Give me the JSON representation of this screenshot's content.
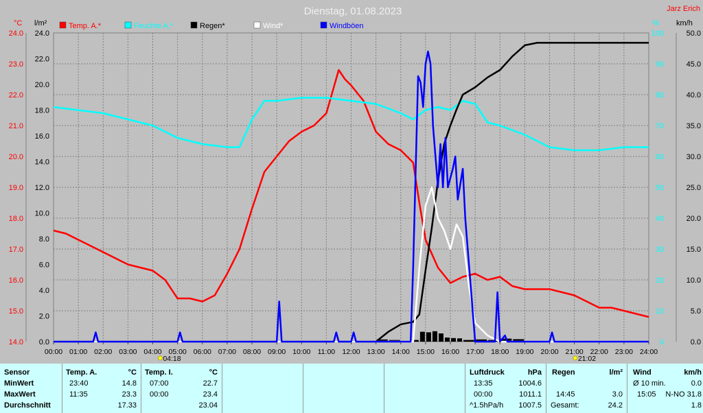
{
  "title": "Dienstag, 01.08.2023",
  "station": "Jarz Erich",
  "units": {
    "temp": "°C",
    "rain": "l/m²",
    "humidity": "%",
    "wind": "km/h"
  },
  "legend": [
    {
      "label": "Temp. A.*",
      "color": "#ff0000"
    },
    {
      "label": "Feuchte A.*",
      "color": "#00ffff"
    },
    {
      "label": "Regen*",
      "color": "#000000"
    },
    {
      "label": "Wind*",
      "color": "#ffffff"
    },
    {
      "label": "Windböen",
      "color": "#0000ff"
    }
  ],
  "sun": {
    "sunrise": "04:18",
    "sunset": "21:02"
  },
  "chart_data": {
    "type": "line",
    "x_unit": "hour",
    "xlim": [
      0,
      24
    ],
    "x_ticks": [
      "00:00",
      "01:00",
      "02:00",
      "03:00",
      "04:00",
      "05:00",
      "06:00",
      "07:00",
      "08:00",
      "09:00",
      "10:00",
      "11:00",
      "12:00",
      "13:00",
      "14:00",
      "15:00",
      "16:00",
      "17:00",
      "18:00",
      "19:00",
      "20:00",
      "21:00",
      "22:00",
      "23:00",
      "24:00"
    ],
    "axes": {
      "temp": {
        "lim": [
          14,
          24
        ],
        "ticks": [
          "14.0",
          "15.0",
          "16.0",
          "17.0",
          "18.0",
          "19.0",
          "20.0",
          "21.0",
          "22.0",
          "23.0",
          "24.0"
        ],
        "color": "#ff0000"
      },
      "rain": {
        "lim": [
          0,
          25
        ],
        "ticks": [
          "0.0",
          "2.0",
          "4.0",
          "6.0",
          "8.0",
          "10.0",
          "12.0",
          "14.0",
          "16.0",
          "18.0",
          "20.0",
          "22.0",
          "24.0"
        ],
        "color": "#000000"
      },
      "humidity": {
        "lim": [
          0,
          100
        ],
        "ticks": [
          "0",
          "10",
          "20",
          "30",
          "40",
          "50",
          "60",
          "70",
          "80",
          "90",
          "100"
        ],
        "color": "#00ffff"
      },
      "wind": {
        "lim": [
          0,
          50
        ],
        "ticks": [
          "0.0",
          "5.0",
          "10.0",
          "15.0",
          "20.0",
          "25.0",
          "30.0",
          "35.0",
          "40.0",
          "45.0",
          "50.0"
        ],
        "color": "#000000"
      }
    },
    "grid": true,
    "series": [
      {
        "name": "Temp. A.*",
        "axis": "temp",
        "color": "#ff0000",
        "x": [
          0,
          0.5,
          1,
          1.5,
          2,
          2.5,
          3,
          3.5,
          4,
          4.5,
          5,
          5.5,
          6,
          6.5,
          7,
          7.5,
          8,
          8.5,
          9,
          9.5,
          10,
          10.5,
          11,
          11.25,
          11.5,
          11.75,
          12,
          12.5,
          13,
          13.5,
          14,
          14.5,
          14.75,
          15,
          15.5,
          16,
          16.5,
          17,
          17.5,
          18,
          18.5,
          19,
          19.5,
          20,
          20.5,
          21,
          21.5,
          22,
          22.5,
          23,
          23.5,
          24
        ],
        "y": [
          17.6,
          17.5,
          17.3,
          17.1,
          16.9,
          16.7,
          16.5,
          16.4,
          16.3,
          16.0,
          15.4,
          15.4,
          15.3,
          15.5,
          16.2,
          17.0,
          18.3,
          19.5,
          20.0,
          20.5,
          20.8,
          21.0,
          21.4,
          22.1,
          22.8,
          22.5,
          22.3,
          21.8,
          20.8,
          20.4,
          20.2,
          19.8,
          18.5,
          17.3,
          16.4,
          15.9,
          16.1,
          16.2,
          16.0,
          16.1,
          15.8,
          15.7,
          15.7,
          15.7,
          15.6,
          15.5,
          15.3,
          15.1,
          15.1,
          15.0,
          14.9,
          14.8
        ]
      },
      {
        "name": "Feuchte A.*",
        "axis": "humidity",
        "color": "#00ffff",
        "x": [
          0,
          1,
          2,
          3,
          4,
          5,
          6,
          7,
          7.5,
          8,
          8.5,
          9,
          10,
          11,
          12,
          13,
          14,
          14.5,
          15,
          15.5,
          16,
          16.5,
          17,
          17.5,
          18,
          19,
          20,
          21,
          22,
          23,
          24
        ],
        "y": [
          76,
          75,
          74,
          72,
          70,
          66,
          64,
          63,
          63,
          72,
          78,
          78,
          79,
          79,
          78,
          77,
          74,
          72,
          75,
          76,
          75,
          78,
          77,
          71,
          70,
          67,
          63,
          62,
          62,
          63,
          63
        ]
      },
      {
        "name": "Regen*",
        "axis": "rain",
        "color": "#000000",
        "x": [
          0,
          13,
          13.5,
          14,
          14.5,
          14.75,
          15,
          15.25,
          15.5,
          15.75,
          16,
          16.25,
          16.5,
          17,
          17.5,
          18,
          18.5,
          19,
          19.5,
          20,
          24
        ],
        "y": [
          0,
          0,
          0.8,
          1.4,
          1.6,
          2.2,
          5.8,
          9.2,
          13.0,
          16.0,
          17.5,
          18.8,
          20.0,
          20.6,
          21.4,
          22.0,
          23.1,
          24.0,
          24.2,
          24.2,
          24.2
        ]
      },
      {
        "name": "Wind*",
        "axis": "wind",
        "color": "#ffffff",
        "x": [
          0,
          14.5,
          14.75,
          15,
          15.25,
          15.5,
          15.75,
          16,
          16.25,
          16.5,
          16.75,
          17,
          17.25,
          17.5,
          17.75,
          18,
          24
        ],
        "y": [
          0,
          0,
          12,
          22,
          25,
          20,
          18,
          15,
          19,
          17,
          9,
          3,
          2,
          1,
          0.5,
          0,
          0
        ]
      },
      {
        "name": "Windböen",
        "axis": "wind",
        "color": "#0000ff",
        "x": [
          0,
          1.6,
          1.7,
          1.8,
          5,
          5.1,
          5.2,
          9,
          9.1,
          9.2,
          11.3,
          11.4,
          11.5,
          12.0,
          12.1,
          12.2,
          12.3,
          14.4,
          14.5,
          14.7,
          14.8,
          14.9,
          15.0,
          15.1,
          15.2,
          15.3,
          15.5,
          15.6,
          15.7,
          15.8,
          15.9,
          16.1,
          16.2,
          16.3,
          16.5,
          16.6,
          16.7,
          17.0,
          17.1,
          17.8,
          17.9,
          18.0,
          18.2,
          18.3,
          20.0,
          20.1,
          20.2,
          24
        ],
        "y": [
          0,
          0,
          1.5,
          0,
          0,
          1.5,
          0,
          0,
          6.5,
          0,
          0,
          1.5,
          0,
          0,
          1.5,
          0,
          0,
          0,
          12,
          43,
          42,
          38,
          45,
          47,
          45,
          35,
          25,
          32,
          25,
          33,
          25,
          28,
          30,
          23,
          28,
          20,
          15,
          0,
          0,
          0,
          8,
          0,
          1,
          0,
          0,
          1.5,
          0,
          0
        ]
      }
    ]
  },
  "table": {
    "sensor": {
      "header": "Sensor",
      "rows": [
        "MinWert",
        "MaxWert",
        "Durchschnitt"
      ]
    },
    "temp_a": {
      "header": "Temp. A.",
      "unit": "°C",
      "rows": [
        {
          "time": "23:40",
          "value": "14.8"
        },
        {
          "time": "11:35",
          "value": "23.3"
        },
        {
          "time": "",
          "value": "17.33"
        }
      ]
    },
    "temp_i": {
      "header": "Temp. I.",
      "unit": "°C",
      "rows": [
        {
          "time": "07:00",
          "value": "22.7"
        },
        {
          "time": "00:00",
          "value": "23.4"
        },
        {
          "time": "",
          "value": "23.04"
        }
      ]
    },
    "pressure": {
      "header": "Luftdruck",
      "unit": "hPa",
      "rows": [
        {
          "time": "13:35",
          "value": "1004.6"
        },
        {
          "time": "00:00",
          "value": "1011.1"
        },
        {
          "time": "^1.5hPa/h",
          "value": "1007.5"
        }
      ]
    },
    "rain": {
      "header": "Regen",
      "unit": "l/m²",
      "rows": [
        {
          "time": "",
          "value": ""
        },
        {
          "time": "14:45",
          "value": "3.0"
        },
        {
          "time": "Gesamt:",
          "value": "24.2"
        }
      ]
    },
    "wind": {
      "header": "Wind",
      "unit": "km/h",
      "rows": [
        {
          "time": "Ø 10 min.",
          "value": "0.0"
        },
        {
          "time": "15:05",
          "value": "N-NO 31.8"
        },
        {
          "time": "",
          "value": "1.8"
        }
      ]
    }
  }
}
